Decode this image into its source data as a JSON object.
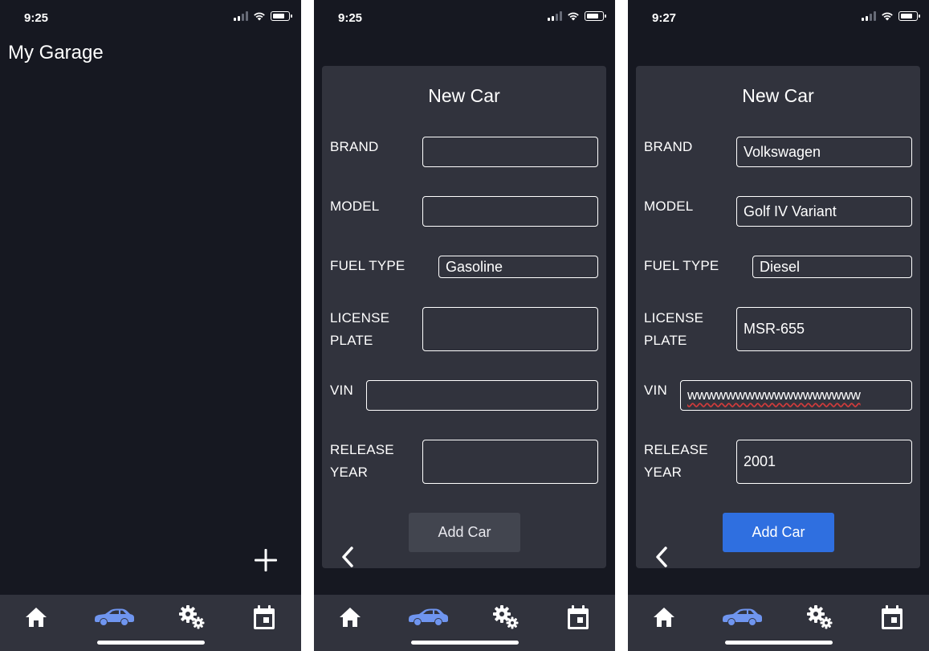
{
  "screens": [
    {
      "status_time": "9:25",
      "title": "My Garage"
    },
    {
      "status_time": "9:25",
      "modal_title": "New Car",
      "labels": {
        "brand": "BRAND",
        "model": "MODEL",
        "fuel_type": "FUEL TYPE",
        "license_plate_line1": "LICENSE",
        "license_plate_line2": "PLATE",
        "vin": "VIN",
        "release_year_line1": "RELEASE",
        "release_year_line2": "YEAR"
      },
      "values": {
        "brand": "",
        "model": "",
        "fuel_type": "Gasoline",
        "license_plate": "",
        "vin": "",
        "release_year": ""
      },
      "add_button_label": "Add Car",
      "add_button_state": "disabled"
    },
    {
      "status_time": "9:27",
      "modal_title": "New Car",
      "labels": {
        "brand": "BRAND",
        "model": "MODEL",
        "fuel_type": "FUEL TYPE",
        "license_plate_line1": "LICENSE",
        "license_plate_line2": "PLATE",
        "vin": "VIN",
        "release_year_line1": "RELEASE",
        "release_year_line2": "YEAR"
      },
      "values": {
        "brand": "Volkswagen",
        "model": "Golf IV Variant",
        "fuel_type": "Diesel",
        "license_plate": "MSR-655",
        "vin": "wwwwwwwwwwwwwwwwww",
        "release_year": "2001"
      },
      "add_button_label": "Add Car",
      "add_button_state": "enabled"
    }
  ],
  "tab_bar": {
    "icons": [
      "home-icon",
      "car-icon",
      "gears-icon",
      "calendar-icon"
    ],
    "active_tab": "car-icon",
    "active_color": "#6f95ef",
    "inactive_color": "#ffffff"
  },
  "colors": {
    "background": "#161821",
    "surface": "#31333d",
    "primary": "#2f6fe0",
    "disabled_button": "#42454f"
  }
}
